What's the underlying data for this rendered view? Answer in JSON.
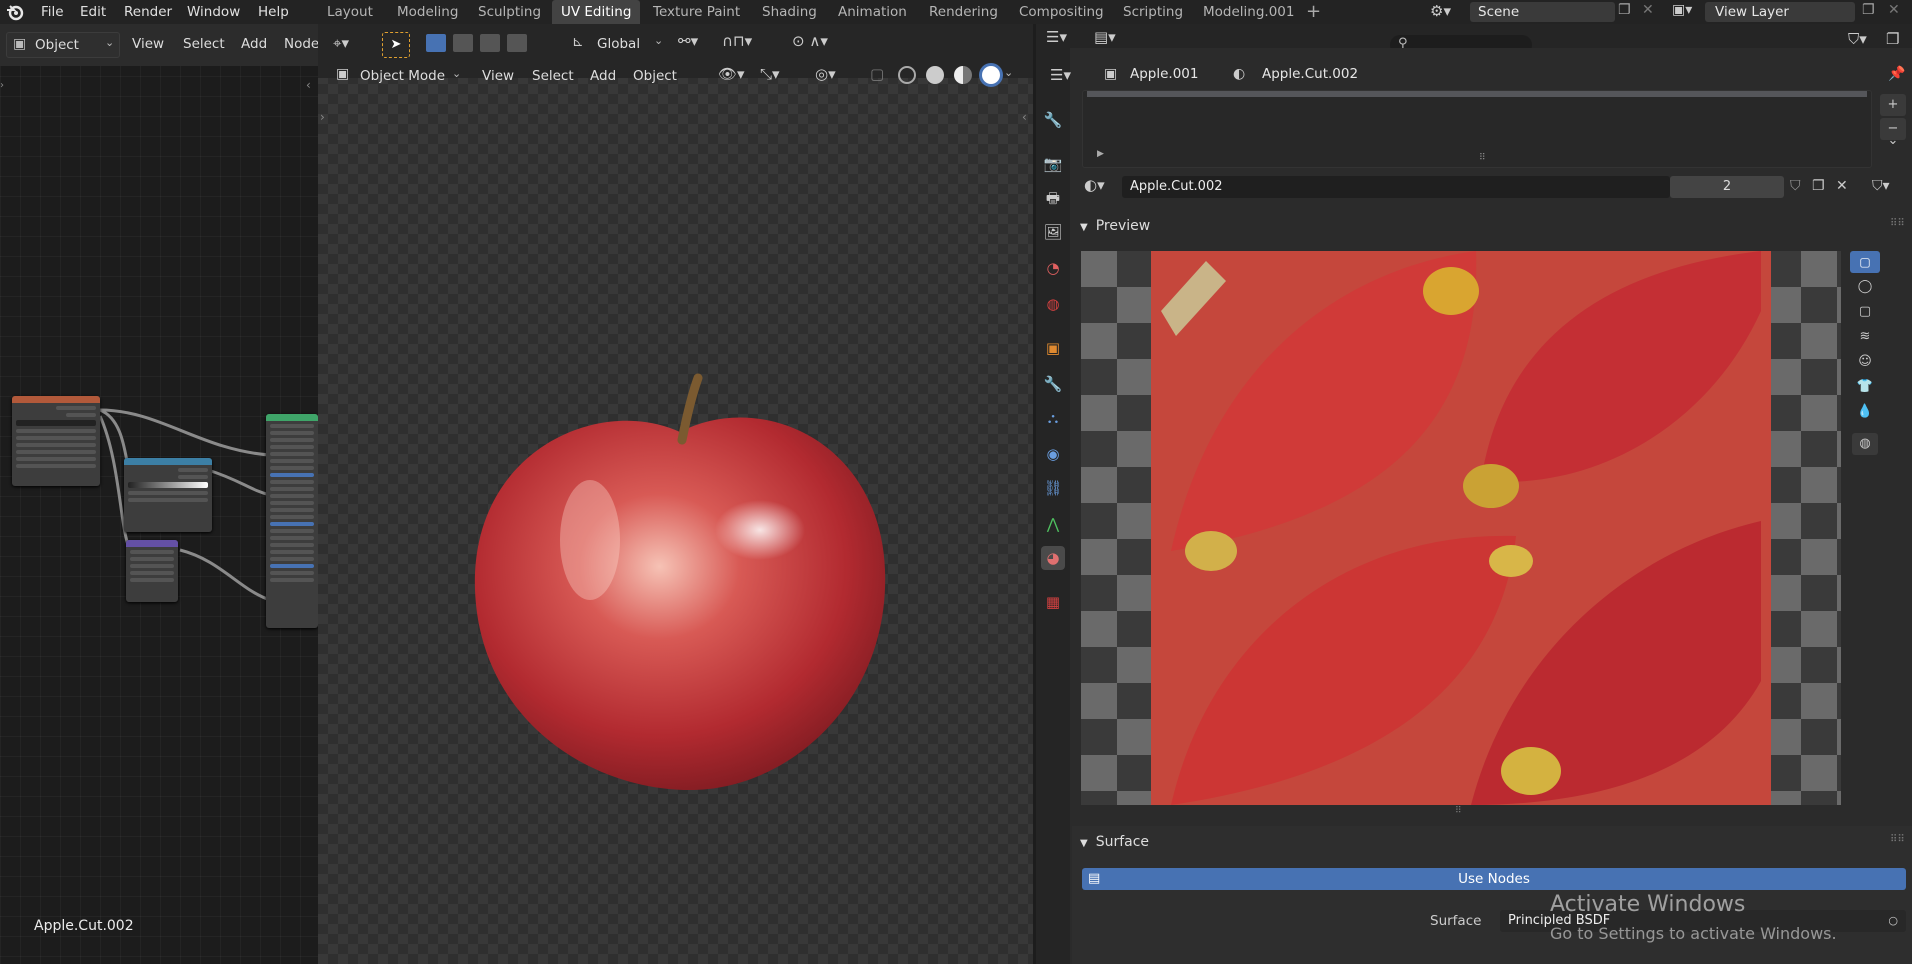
{
  "menu": [
    "File",
    "Edit",
    "Render",
    "Window",
    "Help"
  ],
  "workspaces": [
    "Layout",
    "Modeling",
    "Sculpting",
    "UV Editing",
    "Texture Paint",
    "Shading",
    "Animation",
    "Rendering",
    "Compositing",
    "Scripting",
    "Modeling.001"
  ],
  "active_workspace": "UV Editing",
  "scene": {
    "name": "Scene",
    "view_layer": "View Layer"
  },
  "node_editor": {
    "mode": "Object",
    "menus": [
      "View",
      "Select",
      "Add",
      "Node"
    ],
    "object_label": "Apple.Cut.002"
  },
  "viewport": {
    "transform_orientation": "Global",
    "mode": "Object Mode",
    "menus": [
      "View",
      "Select",
      "Add",
      "Object"
    ]
  },
  "properties": {
    "breadcrumb_object": "Apple.001",
    "breadcrumb_material": "Apple.Cut.002",
    "material_name": "Apple.Cut.002",
    "user_count": "2",
    "preview_label": "Preview",
    "surface_label": "Surface",
    "use_nodes_label": "Use Nodes",
    "surface_field_label": "Surface",
    "surface_shader": "Principled BSDF"
  },
  "watermark": {
    "title": "Activate Windows",
    "subtitle": "Go to Settings to activate Windows."
  },
  "colors": {
    "accent": "#4772b3",
    "header": "#232323",
    "panel": "#2b2b2b"
  }
}
